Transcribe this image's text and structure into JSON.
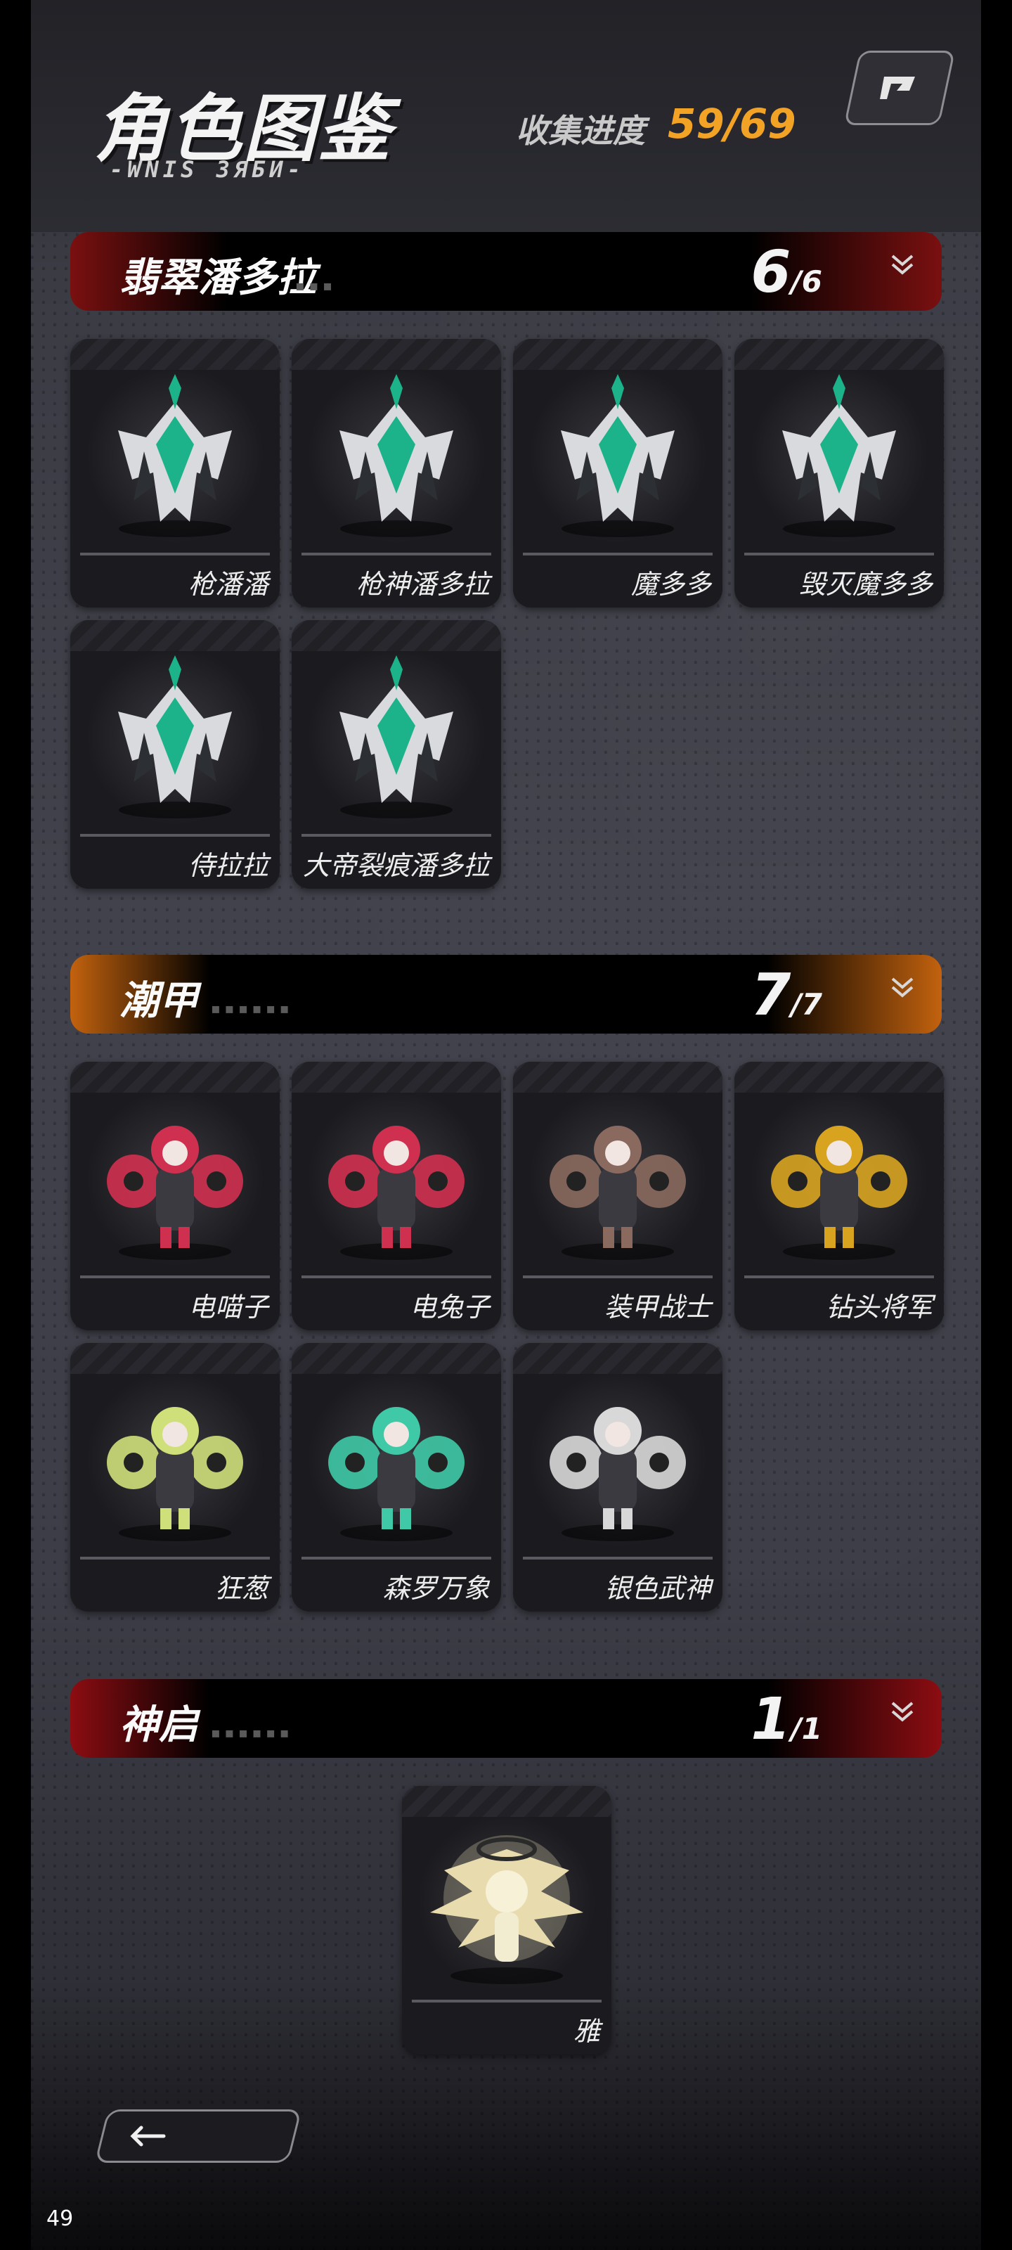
{
  "header": {
    "title": "角色图鉴",
    "subtitle": "-WNIS ЗЯБИ-",
    "progress_label": "收集进度",
    "progress_value": "59/69",
    "colors": {
      "progress": "#f2a325"
    }
  },
  "sections": [
    {
      "name": "翡翠潘多拉",
      "count_have": "6",
      "count_total": "/6",
      "accent": "#8a1414",
      "cards": [
        {
          "label": "枪潘潘",
          "icon": "armored-figure-icon",
          "color": "#1db38a"
        },
        {
          "label": "枪神潘多拉",
          "icon": "armored-figure-icon",
          "color": "#1db38a"
        },
        {
          "label": "魔多多",
          "icon": "armored-figure-icon",
          "color": "#1db38a"
        },
        {
          "label": "毁灭魔多多",
          "icon": "armored-figure-icon",
          "color": "#1db38a"
        },
        {
          "label": "侍拉拉",
          "icon": "armored-figure-icon",
          "color": "#1db38a"
        },
        {
          "label": "大帝裂痕潘多拉",
          "icon": "armored-figure-icon",
          "color": "#1db38a"
        }
      ]
    },
    {
      "name": "潮甲",
      "count_have": "7",
      "count_total": "/7",
      "accent": "#d46a10",
      "cards": [
        {
          "label": "电喵子",
          "icon": "mech-figure-icon",
          "color": "#d0304f"
        },
        {
          "label": "电兔子",
          "icon": "mech-figure-icon",
          "color": "#d0304f"
        },
        {
          "label": "装甲战士",
          "icon": "mech-figure-icon",
          "color": "#8a6a5e"
        },
        {
          "label": "钻头将军",
          "icon": "mech-figure-icon",
          "color": "#d8a420"
        },
        {
          "label": "狂葱",
          "icon": "mech-figure-icon",
          "color": "#cfe07a"
        },
        {
          "label": "森罗万象",
          "icon": "mech-figure-icon",
          "color": "#3fc9a6"
        },
        {
          "label": "银色武神",
          "icon": "mech-figure-icon",
          "color": "#d8d8d8"
        }
      ]
    },
    {
      "name": "神启",
      "count_have": "1",
      "count_total": "/1",
      "accent": "#9a0e14",
      "cards": [
        {
          "label": "雅",
          "icon": "winged-figure-icon",
          "color": "#e8dcae"
        }
      ]
    }
  ],
  "footer": {
    "back_icon": "arrow-left-icon",
    "page_number": "49"
  }
}
